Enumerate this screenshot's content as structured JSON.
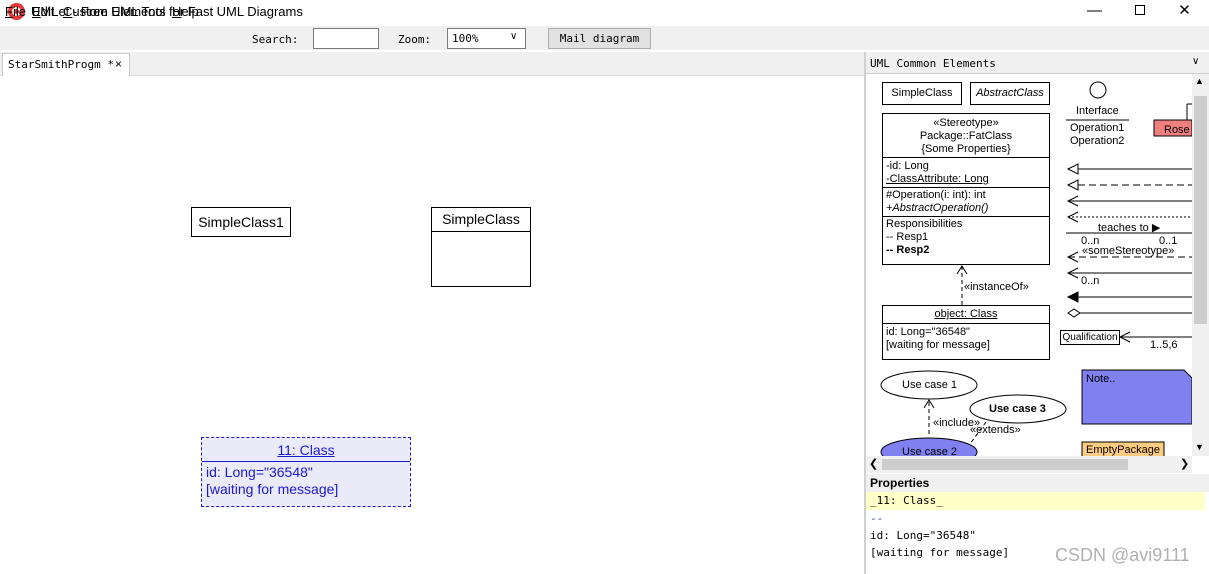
{
  "window": {
    "title": "UMLet - Free UML Tool for Fast UML Diagrams",
    "minimize": "—",
    "close": "✕"
  },
  "menu": {
    "file_u": "F",
    "file_rest": "ile",
    "edit_u": "E",
    "edit_rest": "dit",
    "custom_u": "C",
    "custom_rest": "ustom Elements",
    "help_u": "H",
    "help_rest": "elp"
  },
  "toolbar": {
    "search_label": "Search:",
    "search_value": "",
    "zoom_label": "Zoom:",
    "zoom_value": "100%",
    "mail_button": "Mail diagram"
  },
  "tab": {
    "label": "StarSmithProgm *",
    "close": "×"
  },
  "diagram": {
    "simple_class_1": "SimpleClass1",
    "simple_class_2": "SimpleClass",
    "object": {
      "title": "11: Class",
      "line1": "id: Long=\"36548\"",
      "line2": "[waiting for message]"
    }
  },
  "palette": {
    "header": "UML Common Elements",
    "simple_class": "SimpleClass",
    "abstract_class": "AbstractClass",
    "interface": "Interface",
    "operation1": "Operation1",
    "operation2": "Operation2",
    "rose": "Rose",
    "fat_stereotype": "«Stereotype»",
    "fat_package": "Package::FatClass",
    "fat_props": "{Some Properties}",
    "attr_id": "-id: Long",
    "attr_class": "-ClassAttribute: Long",
    "op1": "#Operation(i: int): int",
    "op2": "+AbstractOperation()",
    "resp_title": "Responsibilities",
    "resp1": "-- Resp1",
    "resp2": "-- Resp2",
    "instance_of": "«instanceOf»",
    "object_title": "object: Class",
    "object_id": "id: Long=\"36548\"",
    "object_wait": "[waiting for message]",
    "teaches_to": "teaches to ▶",
    "mult_0n": "0..n",
    "mult_01": "0..1",
    "some_stereotype": "«someStereotype»",
    "mult_0n_b": "0..n",
    "qualification": "Qualification",
    "mult_156": "1..5,6",
    "use_case_1": "Use case 1",
    "use_case_3": "Use case 3",
    "include": "«include»",
    "extends": "«extends»",
    "note": "Note..",
    "empty_package": "EmptyPackage",
    "use_case_2": "Use case 2",
    "colors": {
      "rose": "#f08080",
      "note": "#8080f0",
      "package": "#ffcc80",
      "usecase2": "#8080f0"
    }
  },
  "properties": {
    "header": "Properties",
    "lines": [
      "_11: Class_",
      "--",
      "id: Long=\"36548\"",
      "[waiting for message]"
    ]
  },
  "watermark": "CSDN @avi9111"
}
